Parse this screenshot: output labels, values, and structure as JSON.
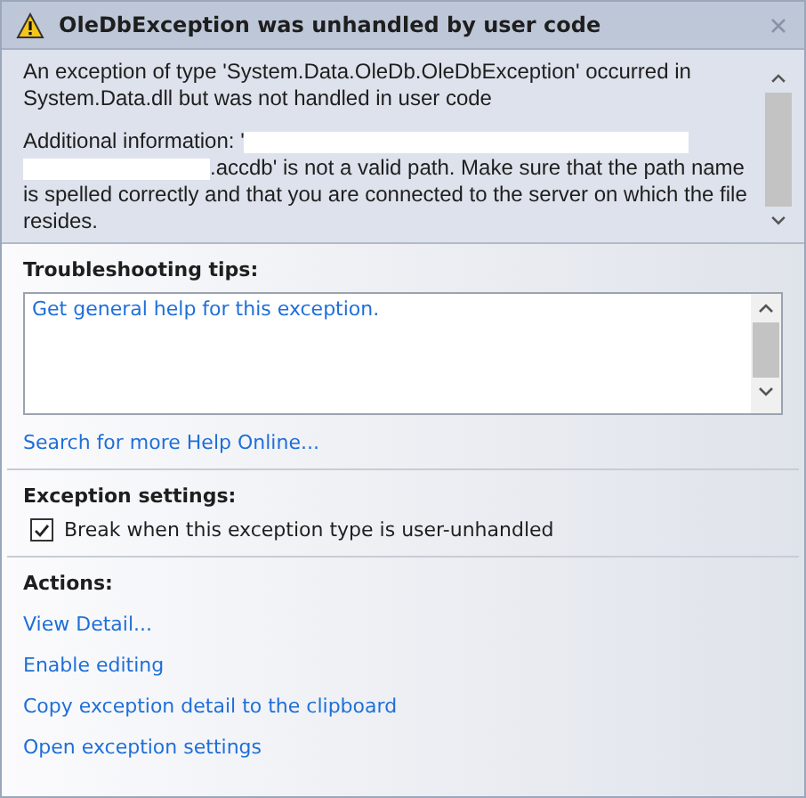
{
  "title": "OleDbException was unhandled by user code",
  "message": {
    "lines": [
      "An exception of type 'System.Data.OleDb.OleDbException' occurred in",
      "System.Data.dll but was not handled in user code"
    ],
    "info_label": "Additional information: '",
    "info_lines": [
      ".accdb' is not a valid path. Make sure that the path name",
      "is spelled correctly and that you are connected to the server on which the file",
      "resides."
    ]
  },
  "troubleshooting": {
    "heading": "Troubleshooting tips:",
    "tips": [
      "Get general help for this exception."
    ],
    "search_link": "Search for more Help Online..."
  },
  "exception_settings": {
    "heading": "Exception settings:",
    "checkbox": {
      "label": "Break when this exception type is user-unhandled",
      "checked": true
    }
  },
  "actions": {
    "heading": "Actions:",
    "links": [
      "View Detail...",
      "Enable editing",
      "Copy exception detail to the clipboard",
      "Open exception settings"
    ]
  }
}
